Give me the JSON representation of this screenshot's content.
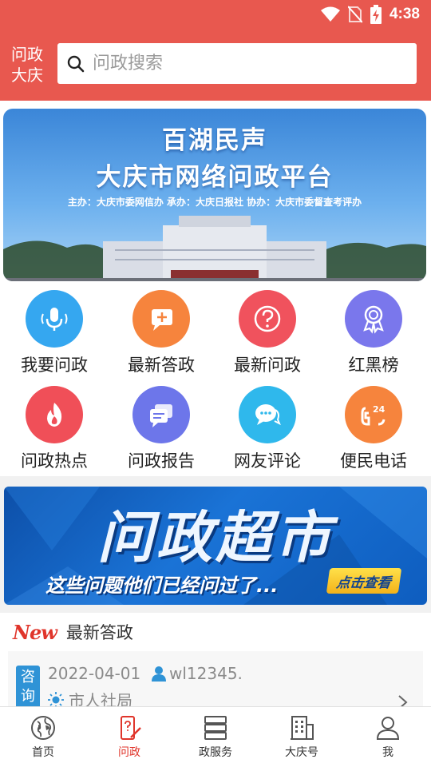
{
  "status_bar": {
    "time": "4:38"
  },
  "header": {
    "brand": "问政大庆",
    "search_placeholder": "问政搜索"
  },
  "banner": {
    "title1": "百湖民声",
    "title2": "大庆市网络问政平台",
    "sponsors": "主办：大庆市委网信办   承办：大庆日报社   协办：大庆市委督查考评办"
  },
  "grid": [
    {
      "label": "我要问政",
      "icon": "microphone-icon",
      "color": "#35a7f0"
    },
    {
      "label": "最新答政",
      "icon": "chat-plus-icon",
      "color": "#f6843d"
    },
    {
      "label": "最新问政",
      "icon": "question-icon",
      "color": "#f0525d"
    },
    {
      "label": "红黑榜",
      "icon": "award-ribbon-icon",
      "color": "#7a77ec"
    },
    {
      "label": "问政热点",
      "icon": "flame-icon",
      "color": "#f04f58"
    },
    {
      "label": "问政报告",
      "icon": "report-chat-icon",
      "color": "#6d76ea"
    },
    {
      "label": "网友评论",
      "icon": "comment-bubbles-icon",
      "color": "#2fb8ec"
    },
    {
      "label": "便民电话",
      "icon": "phone-24-icon",
      "color": "#f6843d"
    }
  ],
  "promo": {
    "title": "问政超市",
    "subtitle": "这些问题他们已经问过了...",
    "button": "点击查看"
  },
  "latest_answers": {
    "badge": "New",
    "title": "最新答政",
    "item": {
      "tag": "咨询",
      "date": "2022-04-01",
      "user": "wl12345.",
      "department": "市人社局"
    }
  },
  "bottom_nav": [
    {
      "label": "首页",
      "icon": "globe-icon",
      "active": false
    },
    {
      "label": "问政",
      "icon": "phone-pen-icon",
      "active": true
    },
    {
      "label": "政服务",
      "icon": "server-stack-icon",
      "active": false
    },
    {
      "label": "大庆号",
      "icon": "building-icon",
      "active": false
    },
    {
      "label": "我",
      "icon": "person-icon",
      "active": false
    }
  ],
  "colors": {
    "brand_red": "#e8584f",
    "active_red": "#e0352b",
    "tag_blue": "#2f93d6"
  }
}
